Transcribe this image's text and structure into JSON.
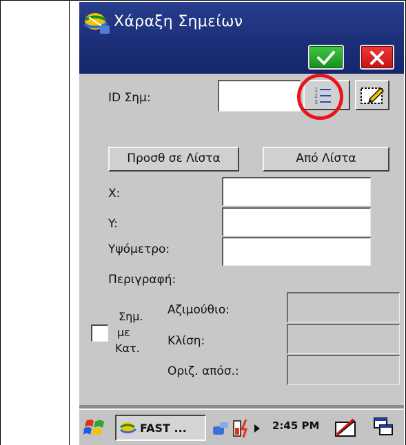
{
  "window": {
    "title": "Χάραξη Σημείων",
    "ok_icon": "checkmark-icon",
    "close_icon": "x-icon",
    "ok_color": "#22a82a",
    "close_color": "#e01c1c"
  },
  "form": {
    "point_id_label": "ID Σημ:",
    "point_id_value": "",
    "list_icon": "numbered-list-icon",
    "edit_icon": "edit-pencil-icon",
    "add_to_list_label": "Προσθ σε Λίστα",
    "from_list_label": "Από Λίστα",
    "x_label": "X:",
    "x_value": "",
    "y_label": "Y:",
    "y_value": "",
    "elevation_label": "Υψόμετρο:",
    "elevation_value": "",
    "description_label": "Περιγραφή:",
    "by_direction_checkbox": {
      "line1": "Σημ.",
      "line2": "με",
      "line3": "Κατ.",
      "checked": false
    },
    "azimuth_label": "Αζιμούθιο:",
    "inclination_label": "Κλίση:",
    "horiz_distance_label": "Οριζ. απόσ.:"
  },
  "annotation": {
    "highlight_color": "#e8141c"
  },
  "taskbar": {
    "start_icon": "windows-flag-icon",
    "task_label": "FAST ...",
    "task_icon": "app-logo-icon",
    "tray_icons": [
      "connection-icon",
      "battery-icon",
      "tray-arrow-icon"
    ],
    "time": "2:45 PM",
    "keyboard_icon": "input-panel-icon",
    "windows_icon": "task-switcher-icon"
  }
}
